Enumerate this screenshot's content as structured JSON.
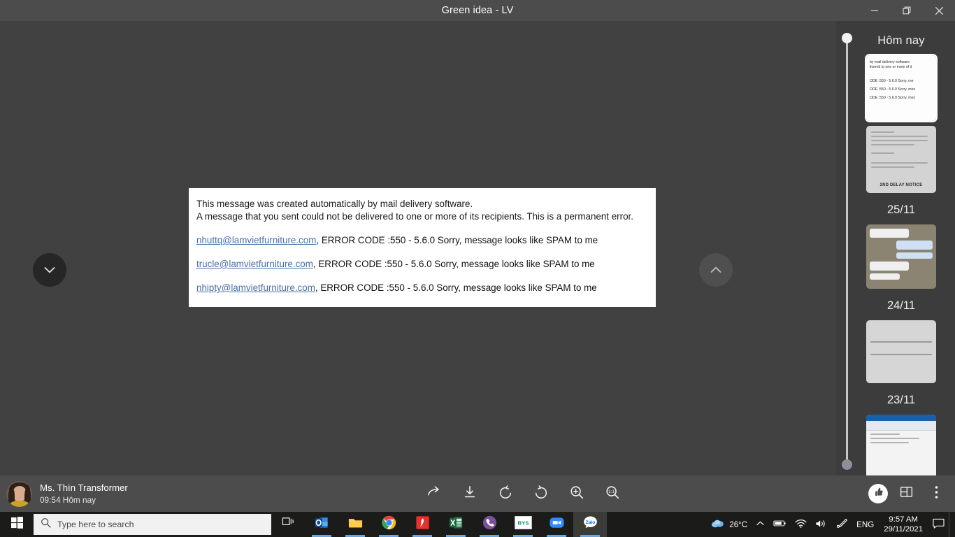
{
  "window": {
    "title": "Green idea - LV",
    "controls": {
      "minimize": "minimize-button",
      "restore": "restore-button",
      "close": "close-button"
    }
  },
  "document": {
    "line1": "This message was created automatically by mail delivery software.",
    "line2": "A message that you sent could not be delivered to one or more of its recipients. This is a permanent error.",
    "errors": [
      {
        "email": "nhuttq@lamvietfurniture.com",
        "message": ", ERROR CODE :550 - 5.6.0 Sorry, message looks like SPAM to me"
      },
      {
        "email": "trucle@lamvietfurniture.com",
        "message": ", ERROR CODE :550 - 5.6.0 Sorry, message looks like SPAM to me"
      },
      {
        "email": "nhipty@lamvietfurniture.com",
        "message": ", ERROR CODE :550 - 5.6.0 Sorry, message looks like SPAM to me"
      }
    ]
  },
  "navigation": {
    "prev_label": "chevron-down-icon",
    "next_label": "chevron-up-icon"
  },
  "sidebar": {
    "today_label": "Hôm nay",
    "groups": [
      {
        "date": "Hôm nay",
        "thumbnails": [
          "mail-error-thumbnail",
          "delay-notice-thumbnail"
        ]
      },
      {
        "date": "25/11",
        "thumbnails": [
          "chat-conversation-thumbnail"
        ]
      },
      {
        "date": "24/11",
        "thumbnails": [
          "note-document-thumbnail"
        ]
      },
      {
        "date": "23/11",
        "thumbnails": [
          "spreadsheet-thumbnail-1",
          "spreadsheet-thumbnail-2"
        ]
      }
    ],
    "dates": [
      "25/11",
      "24/11",
      "23/11"
    ],
    "thumb_mail": {
      "l1": "by mail delivery software.",
      "l2": "livered to one or more of it",
      "l3": "ODE :550 - 5.6.0 Sorry, me",
      "l4": "ODE :550 - 5.6.0 Sorry, mes",
      "l5": "ODE :550 - 5.6.0 Sorry, mes"
    },
    "thumb_doc_notice": "2ND DELAY NOTICE"
  },
  "bottombar": {
    "user_name": "Ms. Thìn Transformer",
    "user_time": "09:54 Hôm nay",
    "tools": [
      {
        "name": "forward-icon",
        "label": "Forward"
      },
      {
        "name": "download-icon",
        "label": "Download"
      },
      {
        "name": "rotate-left-icon",
        "label": "Rotate left"
      },
      {
        "name": "rotate-right-icon",
        "label": "Rotate right"
      },
      {
        "name": "zoom-in-icon",
        "label": "Zoom in"
      },
      {
        "name": "actual-size-icon",
        "label": "1:1"
      }
    ],
    "right_tools": [
      {
        "name": "thumbs-up-icon",
        "label": "Like"
      },
      {
        "name": "panel-layout-icon",
        "label": "Toggle panel"
      },
      {
        "name": "more-options-icon",
        "label": "More"
      }
    ]
  },
  "taskbar": {
    "start_label": "start-button",
    "search_placeholder": "Type here to search",
    "apps": [
      {
        "name": "task-view-icon",
        "label": "Task View"
      },
      {
        "name": "outlook-icon",
        "label": "Outlook"
      },
      {
        "name": "file-explorer-icon",
        "label": "File Explorer"
      },
      {
        "name": "chrome-icon",
        "label": "Google Chrome"
      },
      {
        "name": "pdf-reader-icon",
        "label": "PDF Reader"
      },
      {
        "name": "excel-icon",
        "label": "Excel"
      },
      {
        "name": "viber-icon",
        "label": "Viber"
      },
      {
        "name": "bys-icon",
        "label": "BYS"
      },
      {
        "name": "zoom-app-icon",
        "label": "Zoom"
      },
      {
        "name": "zalo-icon",
        "label": "Zalo"
      }
    ],
    "tray": {
      "weather": "26°C",
      "language": "ENG",
      "time": "9:57 AM",
      "date": "29/11/2021"
    }
  },
  "colors": {
    "background": "#414141",
    "chrome": "#4c4c4c",
    "sidebar": "#3c3c3c",
    "link": "#4a6fa5",
    "taskbar": "#1b1c19"
  }
}
